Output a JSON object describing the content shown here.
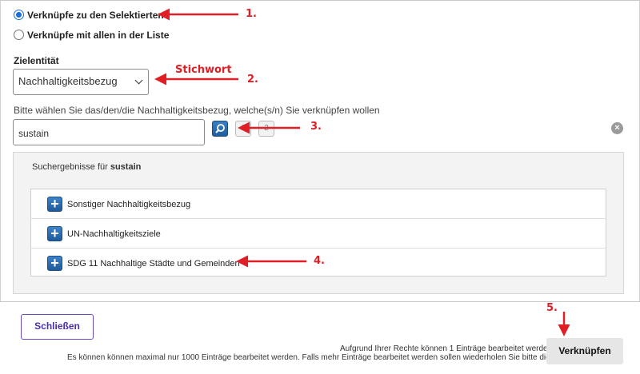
{
  "link_mode": {
    "options": [
      {
        "label": "Verknüpfe zu den Selektierten",
        "checked": true
      },
      {
        "label": "Verknüpfe mit allen in der Liste",
        "checked": false
      }
    ]
  },
  "target_entity": {
    "label": "Zielentität",
    "selected": "Nachhaltigkeitsbezug"
  },
  "search": {
    "hint": "Bitte wählen Sie das/den/die Nachhaltigkeitsbezug, welche(s/n) Sie verknüpfen wollen",
    "value": "sustain",
    "extra_buttons": [
      "1",
      "2"
    ]
  },
  "results": {
    "title_prefix": "Suchergebnisse für",
    "query": "sustain",
    "items": [
      {
        "label": "Sonstiger Nachhaltigkeitsbezug"
      },
      {
        "label": "UN-Nachhaltigkeitsziele"
      },
      {
        "label": "SDG 11 Nachhaltige Städte und Gemeinden"
      }
    ]
  },
  "footer": {
    "close_label": "Schließen",
    "info_line1": "Aufgrund Ihrer Rechte können 1 Einträge bearbeitet werden.",
    "info_line2": "Es können können maximal nur 1000 Einträge bearbeitet werden. Falls mehr Einträge bearbeitet werden sollen wiederholen Sie bitte die Aktion.",
    "link_label": "Verknüpfen"
  },
  "annotations": {
    "step1": "1.",
    "step2_word": "Stichwort",
    "step2": "2.",
    "step3": "3.",
    "step4": "4.",
    "step5": "5.",
    "color": "#e01e25"
  }
}
